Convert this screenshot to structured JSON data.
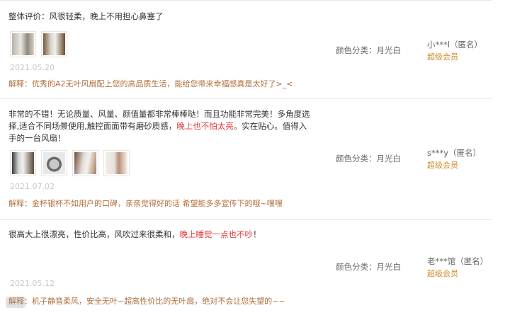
{
  "reviews": [
    {
      "content": "整体评价：风很轻柔，晚上不用担心鼻塞了",
      "highlight": "",
      "content_after": "",
      "images": [
        "fan-photo",
        "fan-photo"
      ],
      "date": "2021.05.20",
      "reply": "解释：优秀的A2无叶风扇配上您的高品质生活，能给您带来幸福感真是太好了>_<",
      "sku": "颜色分类：月光白",
      "user": "小***l（匿名）",
      "level": "超级会员"
    },
    {
      "content": "非常的不错！无论质量、风量、颜值量都非常棒棒哒！而且功能非常完美！多角度选择,适合不同场景使用,触控面面带有磨砂质感，",
      "highlight": "晚上也不怕太亮",
      "content_after": "。实在贴心。值得入手的一台风扇！",
      "images": [
        "fan-photo",
        "fan-photo",
        "fan-photo",
        "fan-photo"
      ],
      "date": "2021.07.02",
      "reply": "解释：金杯银杯不如用户的口碑，亲亲觉得好的话 希望能多多宣传下的哦~嘿嘿",
      "sku": "颜色分类：月光白",
      "user": "s***y（匿名）",
      "level": "超级会员"
    },
    {
      "content": "很高大上很漂亮，性价比高，风吹过来很柔和，",
      "highlight": "晚上睡觉一点也不吵",
      "content_after": "！",
      "images": [],
      "date": "2021.05.12",
      "reply": "解释：机子静音柔风，安全无叶~超高性价比的无叶扇，绝对不会让您失望的~~",
      "sku": "颜色分类：月光白",
      "user": "老***馆（匿名）",
      "level": "超级会员"
    }
  ],
  "colors": {
    "accent_red": "#e4393c",
    "reply_brown": "#b06f3d",
    "vip_gold": "#d08b2f"
  }
}
